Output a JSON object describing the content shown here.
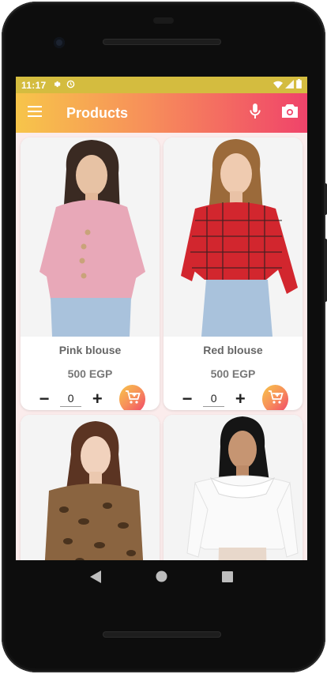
{
  "status_bar": {
    "time": "11:17"
  },
  "app_bar": {
    "title": "Products"
  },
  "products": [
    {
      "name": "Pink blouse",
      "price": "500 EGP",
      "quantity": "0"
    },
    {
      "name": "Red blouse",
      "price": "500 EGP",
      "quantity": "0"
    },
    {
      "name": "",
      "price": "",
      "quantity": ""
    },
    {
      "name": "",
      "price": "",
      "quantity": ""
    }
  ],
  "controls": {
    "minus": "−",
    "plus": "+"
  },
  "icons": {
    "menu": "menu-icon",
    "mic": "mic-icon",
    "camera": "camera-icon",
    "cart": "add-to-cart-icon",
    "back": "back-icon",
    "home": "home-icon",
    "recents": "recents-icon"
  },
  "colors": {
    "status_bar": "#d4bc3f",
    "gradient_start": "#f7c54a",
    "gradient_mid": "#f78f5a",
    "gradient_end": "#f0436a",
    "background": "#fbecec"
  }
}
